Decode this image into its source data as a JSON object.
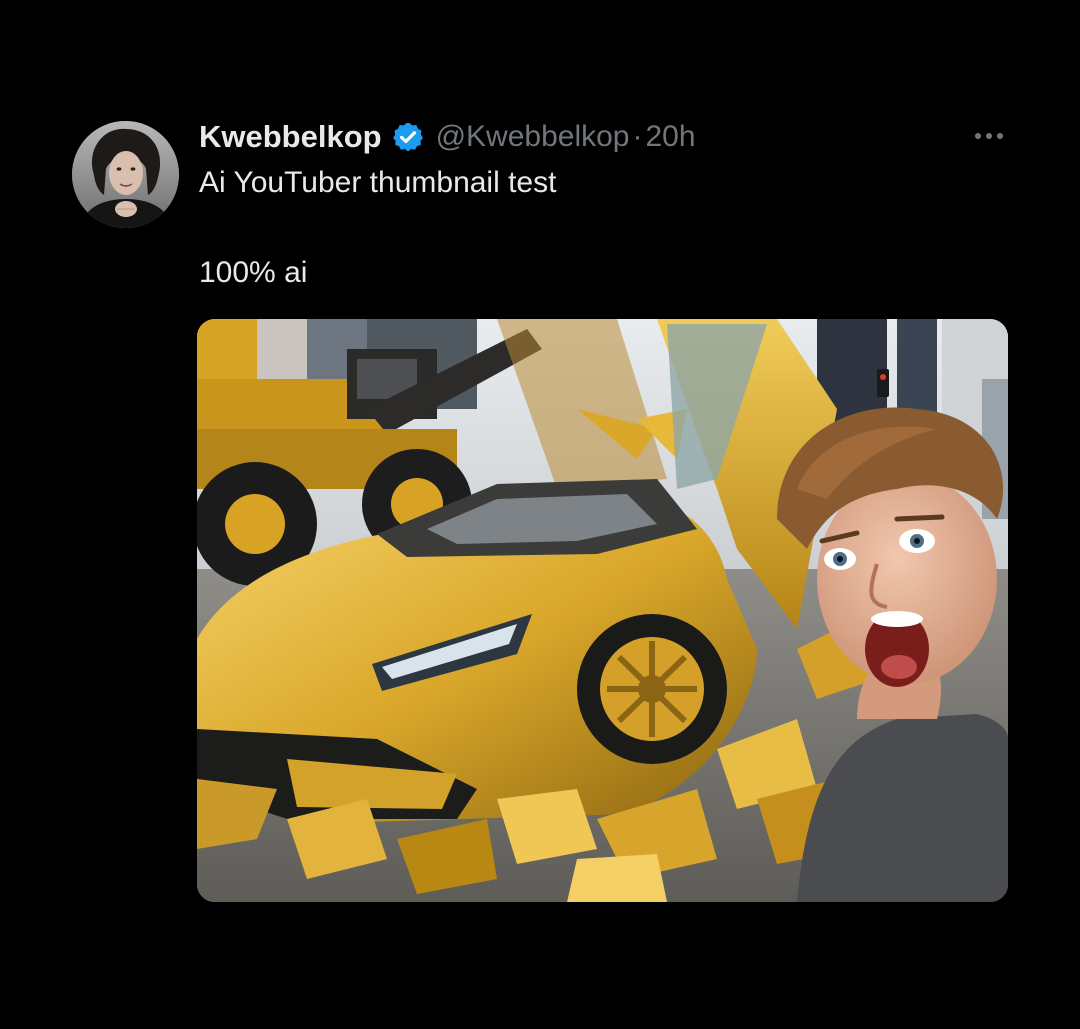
{
  "author": {
    "display_name": "Kwebbelkop",
    "handle": "@Kwebbelkop",
    "separator": "·",
    "timestamp": "20h",
    "verified": true,
    "verified_color": "#1d9bf0"
  },
  "tweet": {
    "line1": "Ai YouTuber thumbnail test",
    "line2": "100% ai"
  },
  "icons": {
    "more": "more-horizontal-icon",
    "verified": "verified-badge-icon"
  },
  "media": {
    "kind": "photo",
    "subject": "golden sports car crushed by a loader, shocked man in foreground"
  },
  "colors": {
    "background": "#000000",
    "primary_text": "#e7e9ea",
    "secondary_text": "#71767b",
    "accent_gold": "#e0b43a"
  }
}
